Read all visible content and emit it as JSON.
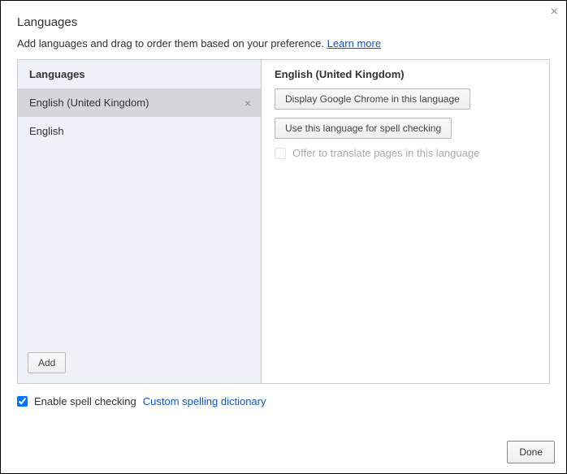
{
  "title": "Languages",
  "subtitle_text": "Add languages and drag to order them based on your preference. ",
  "learn_more": "Learn more",
  "left": {
    "header": "Languages",
    "items": [
      {
        "label": "English (United Kingdom)",
        "selected": true,
        "removable": true
      },
      {
        "label": "English",
        "selected": false,
        "removable": false
      }
    ],
    "add_label": "Add"
  },
  "right": {
    "header": "English (United Kingdom)",
    "display_btn": "Display Google Chrome in this language",
    "spell_btn": "Use this language for spell checking",
    "offer_label": "Offer to translate pages in this language",
    "offer_checked": false,
    "offer_disabled": true
  },
  "spell": {
    "enabled": true,
    "enable_label": "Enable spell checking",
    "dict_link": "Custom spelling dictionary"
  },
  "done_label": "Done"
}
